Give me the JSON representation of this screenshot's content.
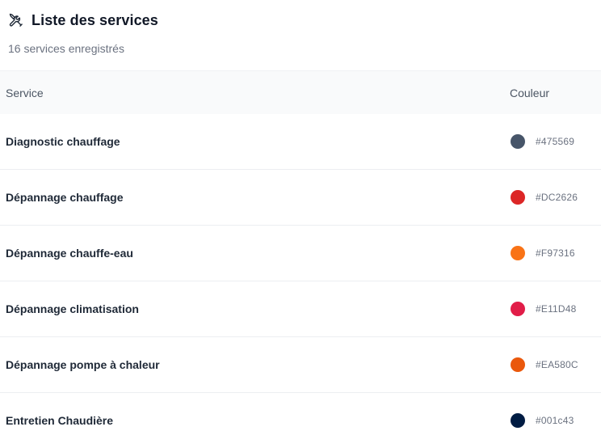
{
  "header": {
    "icon": "tools-icon",
    "title": "Liste des services",
    "subtitle": "16 services enregistrés"
  },
  "table": {
    "columns": {
      "service": "Service",
      "color": "Couleur"
    },
    "rows": [
      {
        "name": "Diagnostic chauffage",
        "color": "#475569",
        "hex_label": "#475569"
      },
      {
        "name": "Dépannage chauffage",
        "color": "#DC2626",
        "hex_label": "#DC2626"
      },
      {
        "name": "Dépannage chauffe-eau",
        "color": "#F97316",
        "hex_label": "#F97316"
      },
      {
        "name": "Dépannage climatisation",
        "color": "#E11D48",
        "hex_label": "#E11D48"
      },
      {
        "name": "Dépannage pompe à chaleur",
        "color": "#EA580C",
        "hex_label": "#EA580C"
      },
      {
        "name": "Entretien Chaudière",
        "color": "#001c43",
        "hex_label": "#001c43"
      }
    ]
  }
}
